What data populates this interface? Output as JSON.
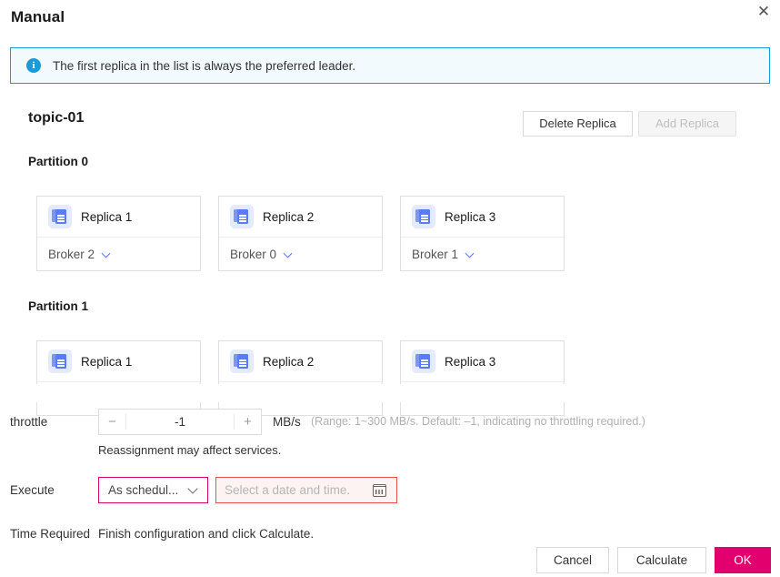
{
  "dialog": {
    "title": "Manual",
    "close_icon": "close-icon"
  },
  "info_banner": {
    "icon": "info-circle-icon",
    "text": "The first replica in the list is always the preferred leader."
  },
  "topic": {
    "name": "topic-01",
    "delete_replica_label": "Delete Replica",
    "add_replica_label": "Add Replica"
  },
  "partitions": [
    {
      "label": "Partition 0",
      "replicas": [
        {
          "icon": "replica-copy-icon",
          "name": "Replica 1",
          "broker": "Broker 2",
          "chevron": "chevron-down-icon"
        },
        {
          "icon": "replica-copy-icon",
          "name": "Replica 2",
          "broker": "Broker 0",
          "chevron": "chevron-down-icon"
        },
        {
          "icon": "replica-copy-icon",
          "name": "Replica 3",
          "broker": "Broker 1",
          "chevron": "chevron-down-icon"
        }
      ]
    },
    {
      "label": "Partition 1",
      "replicas": [
        {
          "icon": "replica-copy-icon",
          "name": "Replica 1"
        },
        {
          "icon": "replica-copy-icon",
          "name": "Replica 2"
        },
        {
          "icon": "replica-copy-icon",
          "name": "Replica 3"
        }
      ]
    }
  ],
  "throttle": {
    "label": "throttle",
    "decrement": "−",
    "increment": "+",
    "value": "-1",
    "unit": "MB/s",
    "hint": "(Range: 1~300 MB/s. Default: –1, indicating no throttling required.)",
    "note": "Reassignment may affect services."
  },
  "execute": {
    "label": "Execute",
    "mode_value": "As schedul...",
    "mode_chevron": "chevron-down-icon",
    "date_placeholder": "Select a date and time.",
    "calendar_icon": "calendar-icon"
  },
  "time_required": {
    "label": "Time Required",
    "value": "Finish configuration and click Calculate."
  },
  "footer": {
    "cancel_label": "Cancel",
    "calculate_label": "Calculate",
    "ok_label": "OK"
  },
  "colors": {
    "accent_pink": "#e1006e",
    "select_border": "#cf0a6b",
    "error_border": "#e8504b",
    "info_blue": "#1a9ad7",
    "replica_blue": "#5b7cf8"
  }
}
